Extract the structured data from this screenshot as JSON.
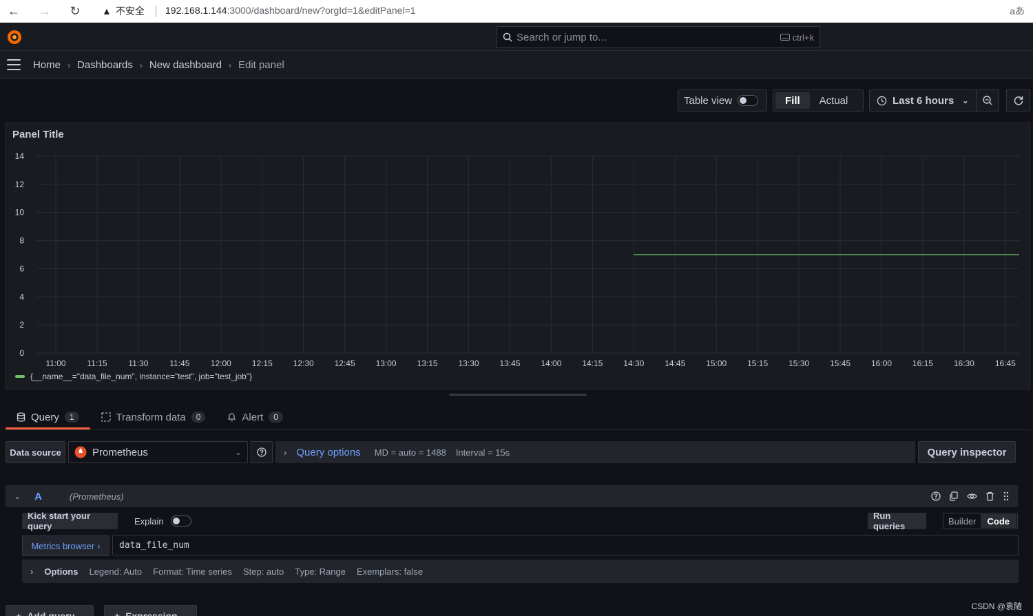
{
  "browser": {
    "warning": "不安全",
    "url_host": "192.168.1.144",
    "url_rest": ":3000/dashboard/new?orgId=1&editPanel=1",
    "reader_icon": "aあ"
  },
  "topbar": {
    "search_placeholder": "Search or jump to...",
    "shortcut": "ctrl+k"
  },
  "breadcrumb": [
    "Home",
    "Dashboards",
    "New dashboard",
    "Edit panel"
  ],
  "toolbar": {
    "table_view": "Table view",
    "fill": "Fill",
    "actual": "Actual",
    "time_range": "Last 6 hours"
  },
  "panel": {
    "title": "Panel Title",
    "legend": "{__name__=\"data_file_num\", instance=\"test\", job=\"test_job\"}"
  },
  "chart_data": {
    "type": "line",
    "y_ticks": [
      "0",
      "2",
      "4",
      "6",
      "8",
      "10",
      "12",
      "14"
    ],
    "ylim": [
      0,
      14
    ],
    "x_ticks": [
      "11:00",
      "11:15",
      "11:30",
      "11:45",
      "12:00",
      "12:15",
      "12:30",
      "12:45",
      "13:00",
      "13:15",
      "13:30",
      "13:45",
      "14:00",
      "14:15",
      "14:30",
      "14:45",
      "15:00",
      "15:15",
      "15:30",
      "15:45",
      "16:00",
      "16:15",
      "16:30",
      "16:45"
    ],
    "series": [
      {
        "values": [
          {
            "x": "14:30",
            "y": 7
          },
          {
            "x": "16:55",
            "y": 7
          }
        ],
        "color": "#73bf69"
      }
    ],
    "grid": true,
    "legend_position": "bottom-left"
  },
  "tabs": [
    {
      "label": "Query",
      "count": "1"
    },
    {
      "label": "Transform data",
      "count": "0"
    },
    {
      "label": "Alert",
      "count": "0"
    }
  ],
  "query_row": {
    "data_source_label": "Data source",
    "data_source": "Prometheus",
    "query_options": "Query options",
    "md": "MD = auto = 1488",
    "interval": "Interval = 15s",
    "inspector": "Query inspector"
  },
  "query_a": {
    "ref": "A",
    "datasource": "(Prometheus)",
    "kick_start": "Kick start your query",
    "explain": "Explain",
    "run": "Run queries",
    "builder": "Builder",
    "code": "Code",
    "metrics_browser": "Metrics browser",
    "expression": "data_file_num",
    "options_label": "Options",
    "legend": "Legend: Auto",
    "format": "Format: Time series",
    "step": "Step: auto",
    "qtype": "Type: Range",
    "exemplars": "Exemplars: false"
  },
  "footer": {
    "add_query": "Add query",
    "expression": "Expression",
    "watermark": "CSDN @袁随"
  }
}
